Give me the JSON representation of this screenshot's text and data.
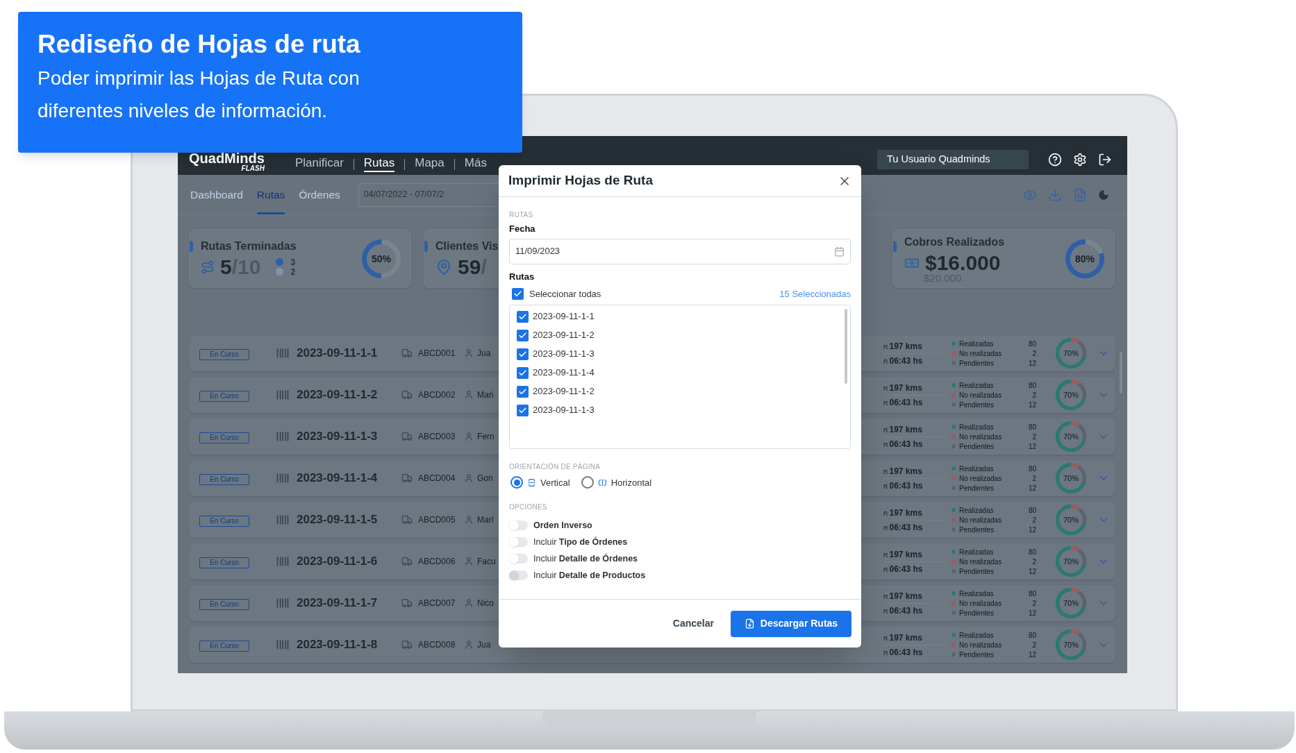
{
  "callout": {
    "title": "Rediseño de Hojas de ruta",
    "text": "Poder imprimir las Hojas de Ruta con diferentes niveles de información."
  },
  "navbar": {
    "logo": "QuadMinds",
    "logo_sub": "FLASH",
    "menu": [
      {
        "label": "Planificar",
        "selected": false
      },
      {
        "label": "Rutas",
        "selected": true
      },
      {
        "label": "Mapa",
        "selected": false
      },
      {
        "label": "Más",
        "selected": false
      }
    ],
    "user": "Tu Usuario Quadminds"
  },
  "subnav": {
    "tabs": [
      {
        "label": "Dashboard",
        "selected": false
      },
      {
        "label": "Rutas",
        "selected": true
      },
      {
        "label": "Órdenes",
        "selected": false
      }
    ],
    "date_range": "04/07/2022 - 07/07/2"
  },
  "cards": [
    {
      "kind": "routes",
      "title": "Rutas Terminadas",
      "value": "5",
      "total": "/10",
      "legend": [
        {
          "value": "3",
          "color": "#2f5fa5"
        },
        {
          "value": "2",
          "color": "#8093ab"
        }
      ],
      "reading": "50%",
      "level": 0.5
    },
    {
      "kind": "clients",
      "title": "Clientes Vis",
      "value": "59",
      "total": "/"
    },
    {
      "kind": "money",
      "title": "Cobros Realizados",
      "value": "$16.000",
      "total": "$20.000",
      "reading": "80%",
      "level": 0.8
    }
  ],
  "routes": [
    {
      "status": "En Curso",
      "id": "2023-09-11-1-1",
      "vehicle": "ABCD001",
      "driver": "Jua",
      "distance_mark": "R",
      "distance": "197 kms",
      "duration_mark": "R",
      "duration": "06:43 hs",
      "stats": [
        {
          "label": "Realizadas",
          "value": "80",
          "color": "#2a7a6f"
        },
        {
          "label": "No realizadas",
          "value": "2",
          "color": "#a05a5f"
        },
        {
          "label": "Pendientes",
          "value": "12",
          "color": "#58636d"
        }
      ],
      "reading": "70%",
      "level": 0.7
    },
    {
      "status": "En Curso",
      "id": "2023-09-11-1-2",
      "vehicle": "ABCD002",
      "driver": "Mari",
      "distance_mark": "R",
      "duration_mark": "R",
      "distance": "197 kms",
      "duration": "06:43 hs",
      "stats": [
        {
          "label": "Realizadas",
          "value": "80",
          "color": "#2a7a6f"
        },
        {
          "label": "No realizadas",
          "value": "2",
          "color": "#a05a5f"
        },
        {
          "label": "Pendientes",
          "value": "12",
          "color": "#58636d"
        }
      ],
      "reading": "70%",
      "level": 0.7
    },
    {
      "status": "En Curso",
      "id": "2023-09-11-1-3",
      "vehicle": "ABCD003",
      "driver": "Fern",
      "distance_mark": "R",
      "duration_mark": "R",
      "distance": "197 kms",
      "duration": "06:43 hs",
      "stats": [
        {
          "label": "Realizadas",
          "value": "80",
          "color": "#2a7a6f"
        },
        {
          "label": "No realizadas",
          "value": "2",
          "color": "#a05a5f"
        },
        {
          "label": "Pendientes",
          "value": "12",
          "color": "#58636d"
        }
      ],
      "reading": "70%",
      "level": 0.7
    },
    {
      "status": "En Curso",
      "id": "2023-09-11-1-4",
      "vehicle": "ABCD004",
      "driver": "Gon",
      "distance_mark": "R",
      "duration_mark": "R",
      "distance": "197 kms",
      "duration": "06:43 hs",
      "stats": [
        {
          "label": "Realizadas",
          "value": "80",
          "color": "#2a7a6f"
        },
        {
          "label": "No realizadas",
          "value": "2",
          "color": "#a05a5f"
        },
        {
          "label": "Pendientes",
          "value": "12",
          "color": "#58636d"
        }
      ],
      "reading": "70%",
      "level": 0.7
    },
    {
      "status": "En Curso",
      "id": "2023-09-11-1-5",
      "vehicle": "ABCD005",
      "driver": "Marí",
      "distance_mark": "R",
      "duration_mark": "R",
      "distance": "197 kms",
      "duration": "06:43 hs",
      "stats": [
        {
          "label": "Realizadas",
          "value": "80",
          "color": "#2a7a6f"
        },
        {
          "label": "No realizadas",
          "value": "2",
          "color": "#a05a5f"
        },
        {
          "label": "Pendientes",
          "value": "12",
          "color": "#58636d"
        }
      ],
      "reading": "70%",
      "level": 0.7
    },
    {
      "status": "En Curso",
      "id": "2023-09-11-1-6",
      "vehicle": "ABCD006",
      "driver": "Facu",
      "distance_mark": "R",
      "duration_mark": "R",
      "distance": "197 kms",
      "duration": "06:43 hs",
      "stats": [
        {
          "label": "Realizadas",
          "value": "80",
          "color": "#2a7a6f"
        },
        {
          "label": "No realizadas",
          "value": "2",
          "color": "#a05a5f"
        },
        {
          "label": "Pendientes",
          "value": "12",
          "color": "#58636d"
        }
      ],
      "reading": "70%",
      "level": 0.7
    },
    {
      "status": "En Curso",
      "id": "2023-09-11-1-7",
      "vehicle": "ABCD007",
      "driver": "Nico",
      "distance_mark": "R",
      "duration_mark": "R",
      "distance": "197 kms",
      "duration": "06:43 hs",
      "stats": [
        {
          "label": "Realizadas",
          "value": "80",
          "color": "#2a7a6f"
        },
        {
          "label": "No realizadas",
          "value": "2",
          "color": "#a05a5f"
        },
        {
          "label": "Pendientes",
          "value": "12",
          "color": "#58636d"
        }
      ],
      "reading": "70%",
      "level": 0.7
    },
    {
      "status": "En Curso",
      "id": "2023-09-11-1-8",
      "vehicle": "ABCD008",
      "driver": "Jua",
      "distance_mark": "R",
      "duration_mark": "R",
      "distance": "197 kms",
      "duration": "06:43 hs",
      "stats": [
        {
          "label": "Realizadas",
          "value": "80",
          "color": "#2a7a6f"
        },
        {
          "label": "No realizadas",
          "value": "2",
          "color": "#a05a5f"
        },
        {
          "label": "Pendientes",
          "value": "12",
          "color": "#58636d"
        }
      ],
      "reading": "70%",
      "level": 0.7
    }
  ],
  "dialog": {
    "title": "Imprimir Hojas de Ruta",
    "section_routes": "RUTAS",
    "date_label": "Fecha",
    "date_value": "11/09/2023",
    "routes_label": "Rutas",
    "select_all": {
      "label": "Seleccionar todas",
      "checked": true
    },
    "selected_count": "15 Seleccionadas",
    "route_options": [
      {
        "label": "2023-09-11-1-1",
        "checked": true
      },
      {
        "label": "2023-09-11-1-2",
        "checked": true
      },
      {
        "label": "2023-09-11-1-3",
        "checked": true
      },
      {
        "label": "2023-09-11-1-4",
        "checked": true
      },
      {
        "label": "2023-09-11-1-2",
        "checked": true
      },
      {
        "label": "2023-09-11-1-3",
        "checked": true
      }
    ],
    "orientation_title": "ORIENTACIÓN DE PÁGINA",
    "orientations": [
      {
        "kind": "vertical",
        "label": "Vertical",
        "selected": true
      },
      {
        "kind": "horizontal",
        "label": "Horizontal",
        "selected": false
      }
    ],
    "options_title": "OPCIONES",
    "options": [
      {
        "label": "Orden Inverso",
        "bold": true,
        "on": false,
        "disabled": false
      },
      {
        "label": "Incluir **Tipo de Órdenes**",
        "bold": false,
        "on": false,
        "disabled": false
      },
      {
        "label": "Incluir **Detalle de Órdenes**",
        "bold": false,
        "on": false,
        "disabled": false
      },
      {
        "label": "Incluir **Detalle de Productos**",
        "bold": false,
        "on": false,
        "disabled": true
      }
    ],
    "cancel": "Cancelar",
    "submit": "Descargar Rutas"
  }
}
